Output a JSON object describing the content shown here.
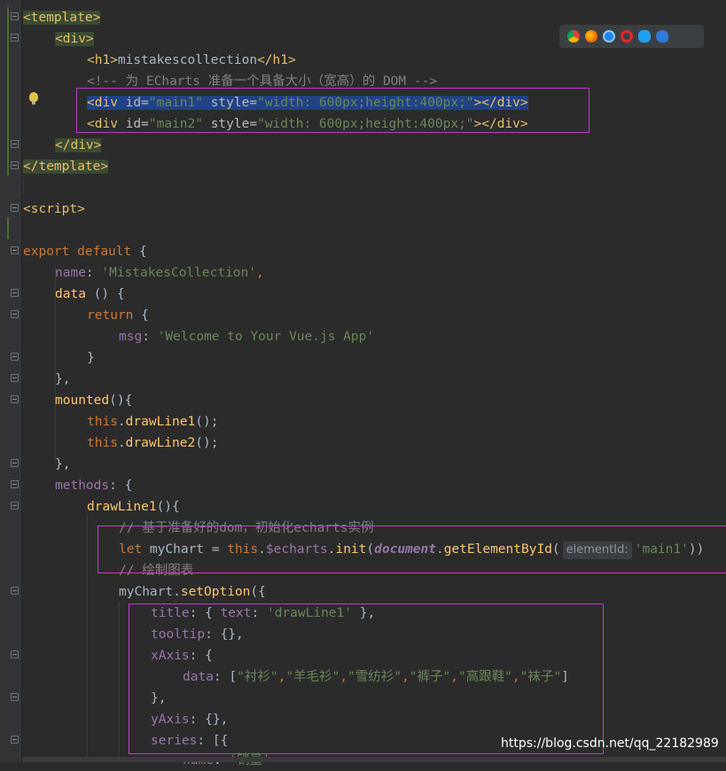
{
  "code": {
    "l1_tag": "<template>",
    "l2_tag": "<div>",
    "l3_open": "<h1>",
    "l3_text": "mistakescollection",
    "l3_close": "</h1>",
    "l4_comment": "<!-- 为 ECharts 准备一个具备大小（宽高）的 DOM -->",
    "l5_open": "<div",
    "l5_attr1": "id=",
    "l5_val1": "\"main1\"",
    "l5_attr2": "style=",
    "l5_val2": "\"width: 600px;height:400px;\"",
    "l5_gt": ">",
    "l5_close": "</div>",
    "l6_open": "<div",
    "l6_attr1": "id=",
    "l6_val1": "\"main2\"",
    "l6_attr2": "style=",
    "l6_val2": "\"width: 600px;height:400px;\"",
    "l6_gt": ">",
    "l6_close": "</div>",
    "l7_tag": "</div>",
    "l8_tag": "</template>",
    "l10_tag": "<script>",
    "l12_export": "export",
    "l12_default": "default",
    "l12_brace": "{",
    "l13_key": "name",
    "l13_colon": ": ",
    "l13_val": "'MistakesCollection'",
    "l13_comma": ",",
    "l14_key": "data",
    "l14_rest": " () {",
    "l15_kw": "return",
    "l15_rest": " {",
    "l16_key": "msg",
    "l16_colon": ": ",
    "l16_val": "'Welcome to Your Vue.js App'",
    "l17": "}",
    "l18": "},",
    "l19_fn": "mounted",
    "l19_rest": "(){",
    "l20_this": "this",
    "l20_dot": ".",
    "l20_fn": "drawLine1",
    "l20_rest": "();",
    "l21_this": "this",
    "l21_dot": ".",
    "l21_fn": "drawLine2",
    "l21_rest": "();",
    "l22": "},",
    "l23_key": "methods",
    "l23_rest": ": {",
    "l24_fn": "drawLine1",
    "l24_rest": "(){",
    "l25_comment": "// 基于准备好的dom，初始化echarts实例",
    "l26_let": "let",
    "l26_var": " myChart = ",
    "l26_this": "this",
    "l26_dot1": ".",
    "l26_echarts": "$echarts",
    "l26_dot2": ".",
    "l26_init": "init",
    "l26_paren": "(",
    "l26_doc": "document",
    "l26_dot3": ".",
    "l26_get": "getElementById",
    "l26_paren2": "(",
    "l26_hint": "elementId:",
    "l26_arg": "'main1'",
    "l26_end": "))",
    "l27_comment": "// 绘制图表",
    "l28_obj": "myChart",
    "l28_dot": ".",
    "l28_fn": "setOption",
    "l28_rest": "({",
    "l29_key": "title",
    "l29_a": ": { ",
    "l29_key2": "text",
    "l29_b": ": ",
    "l29_val": "'drawLine1'",
    "l29_c": " },",
    "l30_key": "tooltip",
    "l30_rest": ": {},",
    "l31_key": "xAxis",
    "l31_rest": ": {",
    "l32_key": "data",
    "l32_a": ": [",
    "l32_v1": "\"衬衫\"",
    "l32_v2": "\"羊毛衫\"",
    "l32_v3": "\"雪纺衫\"",
    "l32_v4": "\"裤子\"",
    "l32_v5": "\"高跟鞋\"",
    "l32_v6": "\"袜子\"",
    "l32_comma": ",",
    "l32_end": "]",
    "l33": "},",
    "l34_key": "yAxis",
    "l34_rest": ": {},",
    "l35_key": "series",
    "l35_rest": ": [{",
    "l36_key": "name",
    "l36_a": ": ",
    "l36_val": "'销量'"
  },
  "watermark": "https://blog.csdn.net/qq_22182989",
  "browser_icons": [
    "chrome-icon",
    "firefox-icon",
    "safari-icon",
    "opera-icon",
    "ie-icon",
    "edge-icon"
  ],
  "colors": {
    "background": "#2b2b2b",
    "tag": "#e8bf6a",
    "string": "#6a8759",
    "keyword": "#cc7832",
    "comment": "#808080",
    "function": "#ffc66d",
    "property": "#9876aa",
    "highlight_box": "#c13cc7",
    "selection": "#214283"
  }
}
